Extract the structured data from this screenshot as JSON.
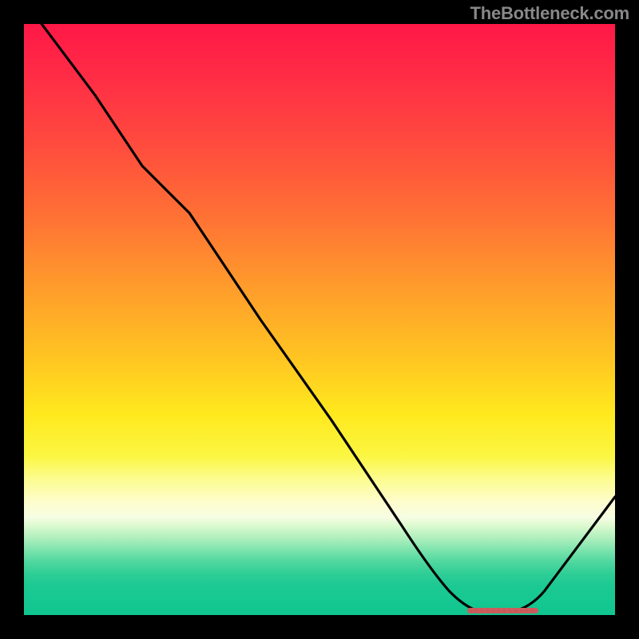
{
  "watermark": "TheBottleneck.com",
  "chart_data": {
    "type": "line",
    "title": "",
    "xlabel": "",
    "ylabel": "",
    "xlim": [
      0,
      100
    ],
    "ylim": [
      0,
      100
    ],
    "grid": false,
    "legend": false,
    "series": [
      {
        "name": "bottleneck-curve",
        "color": "#000000",
        "x": [
          3,
          12,
          20,
          28,
          40,
          52,
          64,
          72,
          76,
          84,
          88,
          100
        ],
        "y": [
          100,
          88,
          76,
          68,
          50,
          33,
          15,
          4,
          1,
          1,
          4,
          20
        ]
      }
    ],
    "annotations": [
      {
        "name": "optimal-range-marker",
        "kind": "hspan-marker",
        "color": "#cd5c5c",
        "x_start": 75,
        "x_end": 87,
        "y": 0.6
      }
    ],
    "background_gradient": {
      "orientation": "vertical",
      "stops": [
        {
          "pos": 0.0,
          "color": "#ff1847"
        },
        {
          "pos": 0.3,
          "color": "#ff6f35"
        },
        {
          "pos": 0.6,
          "color": "#ffe91e"
        },
        {
          "pos": 0.82,
          "color": "#fefdcf"
        },
        {
          "pos": 0.9,
          "color": "#7de3ad"
        },
        {
          "pos": 1.0,
          "color": "#10c690"
        }
      ]
    }
  },
  "colors": {
    "frame": "#000000",
    "curve": "#000000",
    "marker": "#cd5c5c",
    "watermark": "#888888"
  }
}
